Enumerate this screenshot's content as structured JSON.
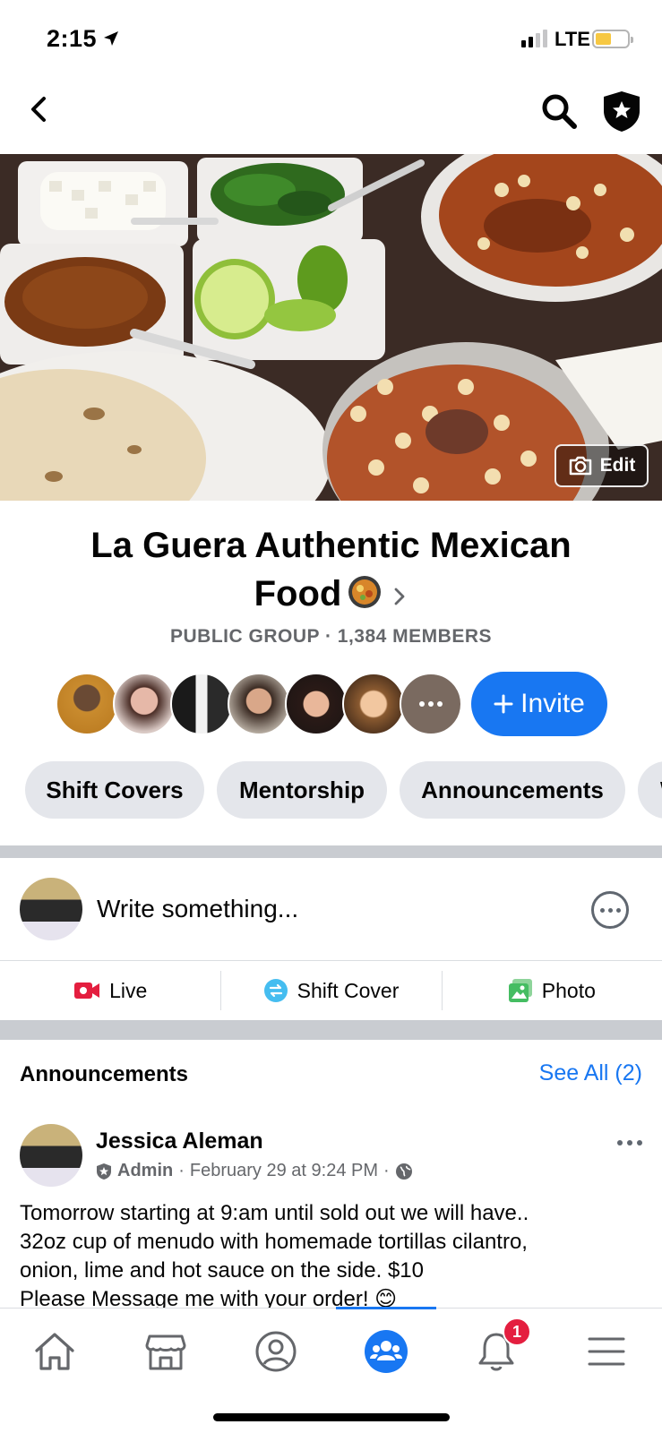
{
  "status_bar": {
    "time": "2:15",
    "network": "LTE",
    "battery_color": "#f7c843"
  },
  "nav": {
    "back_icon": "chevron-left-icon",
    "search_icon": "search-icon",
    "shield_icon": "shield-star-icon"
  },
  "cover": {
    "edit_label": "Edit",
    "description": "menudo"
  },
  "group": {
    "name_line1": "La Guera Authentic Mexican",
    "name_line2": "Food",
    "meta": "PUBLIC GROUP · 1,384 MEMBERS",
    "invite_label": "Invite"
  },
  "chips": [
    "Shift Covers",
    "Mentorship",
    "Announcements",
    "W"
  ],
  "composer": {
    "placeholder": "Write something..."
  },
  "actions": [
    {
      "label": "Live",
      "icon": "live-video-icon",
      "color": "#e41e3f"
    },
    {
      "label": "Shift Cover",
      "icon": "shift-cover-icon",
      "color": "#45bdf0"
    },
    {
      "label": "Photo",
      "icon": "photo-icon",
      "color": "#45bd62"
    }
  ],
  "announcements": {
    "heading": "Announcements",
    "see_all": "See All (2)",
    "post": {
      "author": "Jessica Aleman",
      "role": "Admin",
      "timestamp": "February 29 at 9:24 PM",
      "line1": "Tomorrow starting at 9:am until sold out we will have..",
      "line2": "32oz cup of menudo with homemade tortillas  cilantro,",
      "line3": "onion, lime and hot sauce on the side. $10",
      "line4": "Please Message me with your order! 😊"
    }
  },
  "tabbar": {
    "tabs": [
      "home-icon",
      "marketplace-icon",
      "profile-icon",
      "groups-icon",
      "notifications-icon",
      "menu-icon"
    ],
    "active": "groups-icon",
    "notification_count": "1",
    "accent": "#1877f2"
  }
}
